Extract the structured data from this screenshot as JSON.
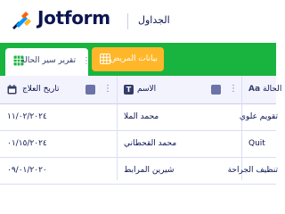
{
  "header": {
    "brand": "Jotform",
    "page_title": "الجداول"
  },
  "tabs": [
    {
      "label": "تقرير سير الحالة",
      "active": true
    },
    {
      "label": "بيانات المريض",
      "active": false
    }
  ],
  "colors": {
    "tabbar": "#18b43f",
    "active_tab": "#ffffff",
    "orange_tab": "#ffb629",
    "header_row": "#f3f3fe",
    "brand_text": "#0a1551"
  },
  "table": {
    "columns": [
      {
        "label": "تاريخ العلاج",
        "type_icon": "calendar-icon"
      },
      {
        "label": "الاسم",
        "type_icon": "text-type-icon"
      },
      {
        "label": "الحالة",
        "type_icon": "Aa"
      }
    ],
    "rows": [
      {
        "date": "١١/٠٢/٢٠٢٤",
        "name": "محمد الملا",
        "status": "تقويم علوي"
      },
      {
        "date": "٠١/١٥/٢٠٢٤",
        "name": "محمد القحطاني",
        "status": "Quit"
      },
      {
        "date": "٠٩/٠١/٢٠٢٠",
        "name": "شيرين المرابط",
        "status": "تنظيف الجراحة"
      }
    ]
  }
}
